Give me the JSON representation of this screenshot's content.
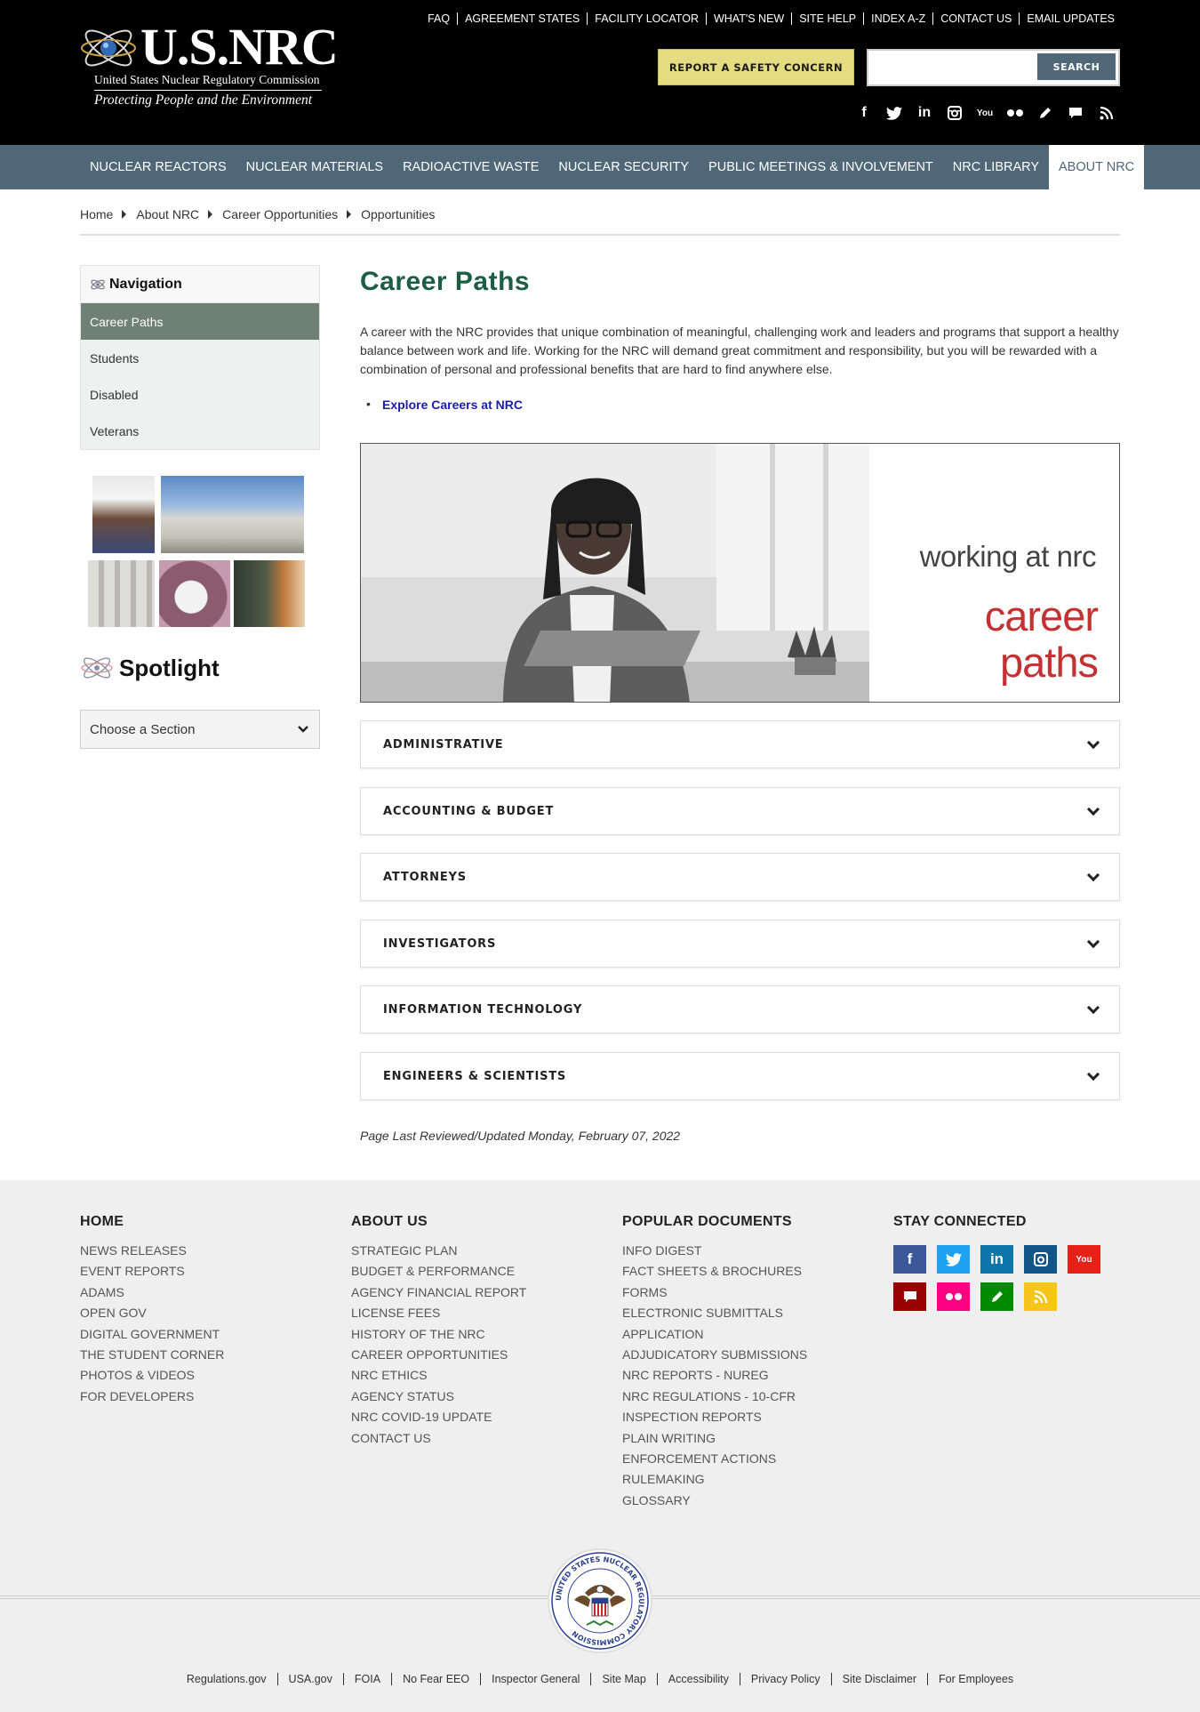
{
  "header": {
    "logo_wordmark": "U.S.NRC",
    "logo_agency": "United States Nuclear Regulatory Commission",
    "logo_tagline": "Protecting People and the Environment",
    "utility_links": [
      "FAQ",
      "AGREEMENT STATES",
      "FACILITY LOCATOR",
      "WHAT'S NEW",
      "SITE HELP",
      "INDEX A-Z",
      "CONTACT US",
      "EMAIL UPDATES"
    ],
    "report_button": "REPORT A SAFETY CONCERN",
    "search_value": "",
    "search_button": "SEARCH",
    "social_icons": [
      "facebook-icon",
      "twitter-icon",
      "linkedin-icon",
      "instagram-icon",
      "youtube-icon",
      "flickr-icon",
      "blog-pencil-icon",
      "comment-icon",
      "rss-icon"
    ]
  },
  "main_nav": {
    "items": [
      "NUCLEAR REACTORS",
      "NUCLEAR MATERIALS",
      "RADIOACTIVE WASTE",
      "NUCLEAR SECURITY",
      "PUBLIC MEETINGS & INVOLVEMENT",
      "NRC LIBRARY",
      "ABOUT NRC"
    ],
    "active": "ABOUT NRC"
  },
  "breadcrumb": [
    "Home",
    "About NRC",
    "Career Opportunities",
    "Opportunities"
  ],
  "sidebar": {
    "nav_heading": "Navigation",
    "items": [
      "Career Paths",
      "Students",
      "Disabled",
      "Veterans"
    ],
    "active": "Career Paths",
    "spotlight_heading": "Spotlight",
    "section_select": "Choose a Section"
  },
  "content": {
    "title": "Career Paths",
    "intro": "A career with the NRC provides that unique combination of meaningful, challenging work and leaders and programs that support a healthy balance between work and life. Working for the NRC will demand great commitment and responsibility, but you will be rewarded with a combination of personal and professional benefits that are hard to find anywhere else.",
    "explore_link": "Explore Careers at NRC",
    "banner_line1": "working at nrc",
    "banner_line2": "career",
    "banner_line3": "paths",
    "accordions": [
      "ADMINISTRATIVE",
      "ACCOUNTING & BUDGET",
      "ATTORNEYS",
      "INVESTIGATORS",
      "INFORMATION TECHNOLOGY",
      "ENGINEERS & SCIENTISTS"
    ],
    "last_updated": "Page Last Reviewed/Updated Monday, February 07, 2022"
  },
  "footer": {
    "col1": {
      "heading": "HOME",
      "links": [
        "NEWS RELEASES",
        "EVENT REPORTS",
        "ADAMS",
        "OPEN GOV",
        "DIGITAL GOVERNMENT",
        "THE STUDENT CORNER",
        "PHOTOS & VIDEOS",
        "FOR DEVELOPERS"
      ]
    },
    "col2": {
      "heading": "ABOUT US",
      "links": [
        "STRATEGIC PLAN",
        "BUDGET & PERFORMANCE",
        "AGENCY FINANCIAL REPORT",
        "LICENSE FEES",
        "HISTORY OF THE NRC",
        "CAREER OPPORTUNITIES",
        "NRC ETHICS",
        "AGENCY STATUS",
        "NRC COVID-19 UPDATE",
        "CONTACT US"
      ]
    },
    "col3": {
      "heading": "POPULAR DOCUMENTS",
      "links": [
        "INFO DIGEST",
        "FACT SHEETS & BROCHURES",
        "FORMS",
        "ELECTRONIC SUBMITTALS",
        "APPLICATION",
        "ADJUDICATORY SUBMISSIONS",
        "NRC REPORTS - NUREG",
        "NRC REGULATIONS - 10-CFR",
        "INSPECTION REPORTS",
        "PLAIN WRITING",
        "ENFORCEMENT ACTIONS",
        "RULEMAKING",
        "GLOSSARY"
      ]
    },
    "col4": {
      "heading": "STAY CONNECTED"
    },
    "social_colors": {
      "facebook": "#3b5998",
      "twitter": "#1da1f2",
      "linkedin": "#0e76a8",
      "instagram": "#125688",
      "youtube": "#e62117",
      "comment": "#990000",
      "flickr": "#ff0084",
      "blog": "#008a00",
      "rss": "#f5c518"
    },
    "seal_text": "UNITED STATES NUCLEAR REGULATORY COMMISSION",
    "legal_links": [
      "Regulations.gov",
      "USA.gov",
      "FOIA",
      "No Fear EEO",
      "Inspector General",
      "Site Map",
      "Accessibility",
      "Privacy Policy",
      "Site Disclaimer",
      "For Employees"
    ]
  }
}
